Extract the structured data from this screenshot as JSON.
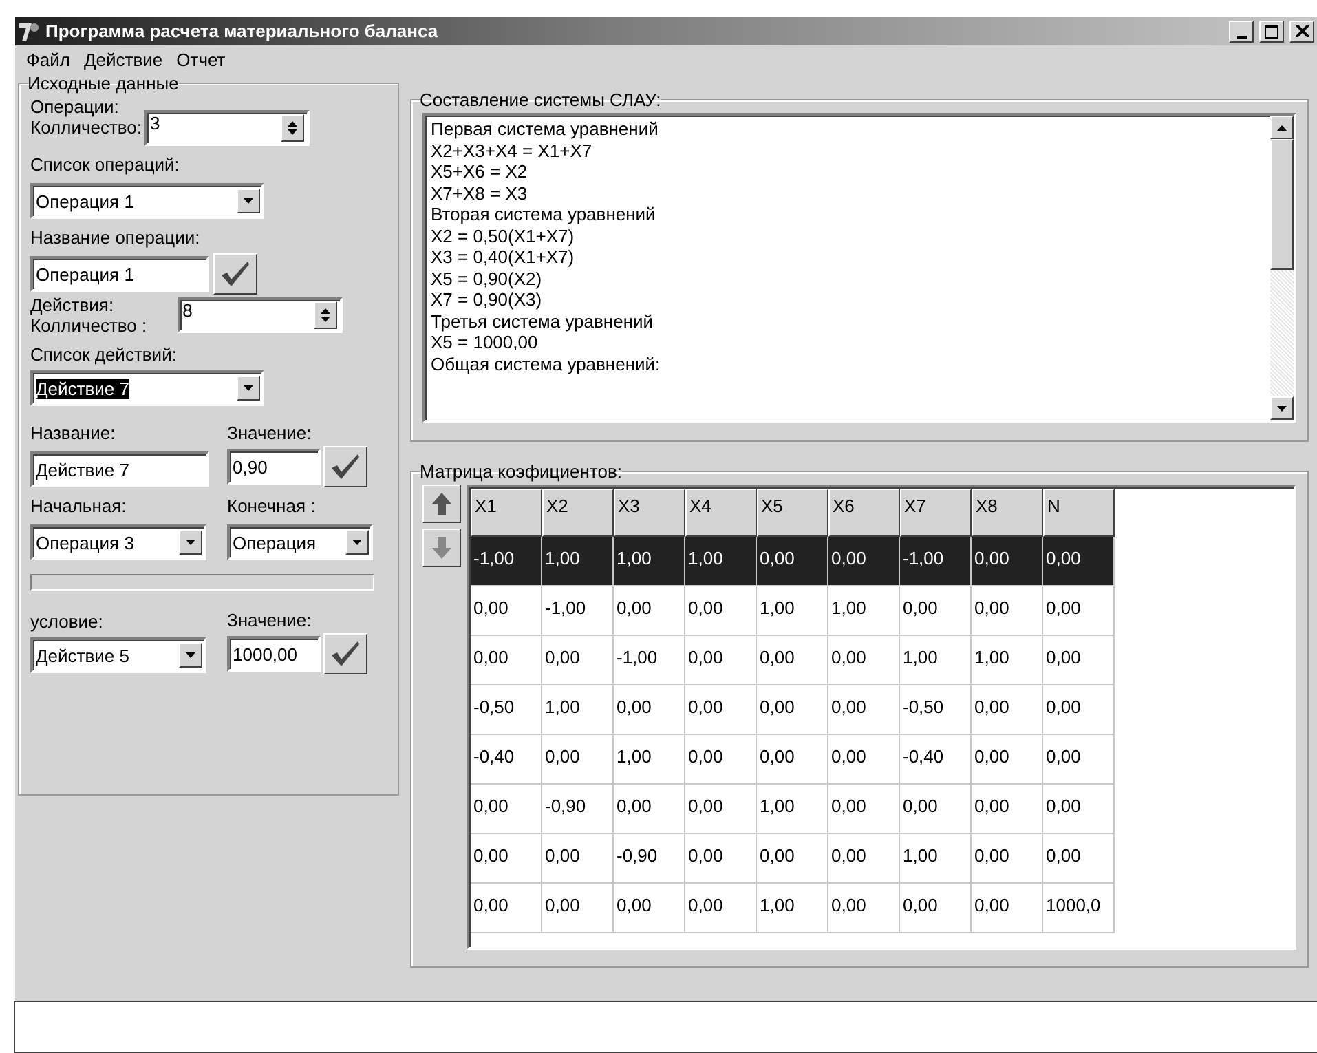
{
  "window": {
    "title": "Программа расчета материального баланса"
  },
  "menu": [
    "Файл",
    "Действие",
    "Отчет"
  ],
  "source_panel": {
    "title": "Исходные данные",
    "operations": {
      "caption": "Операции:",
      "count_label": "Колличество:",
      "count": "3"
    },
    "operation_list": {
      "label": "Список операций:",
      "value": "Операция 1",
      "focused": false
    },
    "operation_name": {
      "label": "Название операции:",
      "value": "Операция 1"
    },
    "actions": {
      "caption": "Действия:",
      "count_label": "Колличество :",
      "count": "8"
    },
    "action_list": {
      "label": "Список действий:",
      "value": "Действие 7",
      "focused": true
    },
    "action_name": {
      "label": "Название:",
      "value": "Действие 7"
    },
    "action_value": {
      "label": "Значение:",
      "value": "0,90"
    },
    "start": {
      "label": "Начальная:",
      "value": "Операция 3"
    },
    "end": {
      "label": "Конечная :",
      "value": "Операция"
    },
    "condition": {
      "label": "условие:",
      "value": "Действие 5"
    },
    "condition_value": {
      "label": "Значение:",
      "value": "1000,00"
    }
  },
  "slau_panel": {
    "title": "Составление системы СЛАУ:",
    "lines": [
      "Первая система уравнений",
      "X2+X3+X4 = X1+X7",
      "X5+X6 = X2",
      "X7+X8 = X3",
      "Вторая система уравнений",
      "X2 = 0,50(X1+X7)",
      "X3 = 0,40(X1+X7)",
      "X5 = 0,90(X2)",
      "X7 = 0,90(X3)",
      "Третья система уравнений",
      "X5 = 1000,00",
      "Общая система уравнений:"
    ]
  },
  "matrix_panel": {
    "title": "Матрица коэфициентов:",
    "columns": [
      "X1",
      "X2",
      "X3",
      "X4",
      "X5",
      "X6",
      "X7",
      "X8",
      "N"
    ],
    "rows": [
      {
        "selected": true,
        "cells": [
          "-1,00",
          "1,00",
          "1,00",
          "1,00",
          "0,00",
          "0,00",
          "-1,00",
          "0,00",
          "0,00"
        ]
      },
      {
        "selected": false,
        "cells": [
          "0,00",
          "-1,00",
          "0,00",
          "0,00",
          "1,00",
          "1,00",
          "0,00",
          "0,00",
          "0,00"
        ]
      },
      {
        "selected": false,
        "cells": [
          "0,00",
          "0,00",
          "-1,00",
          "0,00",
          "0,00",
          "0,00",
          "1,00",
          "1,00",
          "0,00"
        ]
      },
      {
        "selected": false,
        "cells": [
          "-0,50",
          "1,00",
          "0,00",
          "0,00",
          "0,00",
          "0,00",
          "-0,50",
          "0,00",
          "0,00"
        ]
      },
      {
        "selected": false,
        "cells": [
          "-0,40",
          "0,00",
          "1,00",
          "0,00",
          "0,00",
          "0,00",
          "-0,40",
          "0,00",
          "0,00"
        ]
      },
      {
        "selected": false,
        "cells": [
          "0,00",
          "-0,90",
          "0,00",
          "0,00",
          "1,00",
          "0,00",
          "0,00",
          "0,00",
          "0,00"
        ]
      },
      {
        "selected": false,
        "cells": [
          "0,00",
          "0,00",
          "-0,90",
          "0,00",
          "0,00",
          "0,00",
          "1,00",
          "0,00",
          "0,00"
        ]
      },
      {
        "selected": false,
        "cells": [
          "0,00",
          "0,00",
          "0,00",
          "0,00",
          "1,00",
          "0,00",
          "0,00",
          "0,00",
          "1000,0"
        ]
      }
    ]
  }
}
